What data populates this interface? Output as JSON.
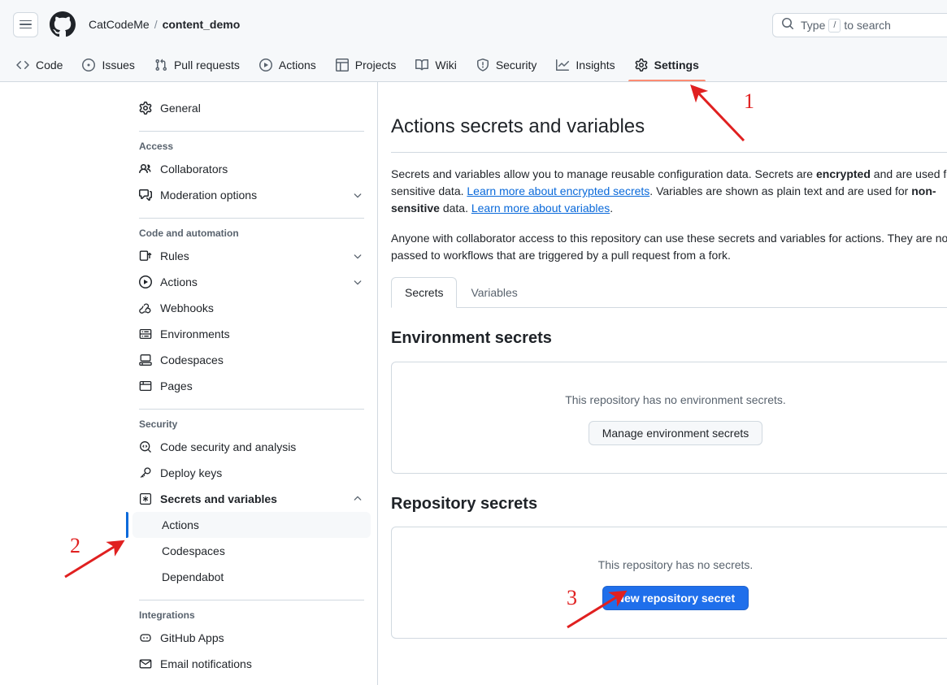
{
  "header": {
    "menu_icon": "hamburger-menu-icon",
    "logo_icon": "github-logo-icon",
    "owner": "CatCodeMe",
    "separator": "/",
    "repo": "content_demo",
    "search": {
      "icon": "search-icon",
      "prefix": "Type",
      "key": "/",
      "suffix": "to search",
      "placeholder": "Type / to search"
    }
  },
  "repo_nav": {
    "items": [
      {
        "label": "Code",
        "icon": "code-icon",
        "active": false
      },
      {
        "label": "Issues",
        "icon": "issue-opened-icon",
        "active": false
      },
      {
        "label": "Pull requests",
        "icon": "git-pull-request-icon",
        "active": false
      },
      {
        "label": "Actions",
        "icon": "play-icon",
        "active": false
      },
      {
        "label": "Projects",
        "icon": "table-icon",
        "active": false
      },
      {
        "label": "Wiki",
        "icon": "book-icon",
        "active": false
      },
      {
        "label": "Security",
        "icon": "shield-icon",
        "active": false
      },
      {
        "label": "Insights",
        "icon": "graph-icon",
        "active": false
      },
      {
        "label": "Settings",
        "icon": "gear-icon",
        "active": true
      }
    ],
    "active_underline_color": "#fd8c73"
  },
  "sidebar": {
    "general": {
      "label": "General",
      "icon": "gear-icon"
    },
    "sections": [
      {
        "title": "Access",
        "items": [
          {
            "label": "Collaborators",
            "icon": "people-icon",
            "chevron": ""
          },
          {
            "label": "Moderation options",
            "icon": "comment-discussion-icon",
            "chevron": "chevron-down-icon"
          }
        ]
      },
      {
        "title": "Code and automation",
        "items": [
          {
            "label": "Rules",
            "icon": "rules-icon",
            "chevron": "chevron-down-icon"
          },
          {
            "label": "Actions",
            "icon": "play-icon",
            "chevron": "chevron-down-icon"
          },
          {
            "label": "Webhooks",
            "icon": "webhook-icon",
            "chevron": ""
          },
          {
            "label": "Environments",
            "icon": "environment-icon",
            "chevron": ""
          },
          {
            "label": "Codespaces",
            "icon": "codespaces-icon",
            "chevron": ""
          },
          {
            "label": "Pages",
            "icon": "browser-icon",
            "chevron": ""
          }
        ]
      },
      {
        "title": "Security",
        "items": [
          {
            "label": "Code security and analysis",
            "icon": "codescan-icon",
            "chevron": ""
          },
          {
            "label": "Deploy keys",
            "icon": "key-icon",
            "chevron": ""
          },
          {
            "label": "Secrets and variables",
            "icon": "asterisk-icon",
            "chevron": "chevron-up-icon",
            "bold": true
          }
        ],
        "subitems": [
          {
            "label": "Actions",
            "selected": true
          },
          {
            "label": "Codespaces",
            "selected": false
          },
          {
            "label": "Dependabot",
            "selected": false
          }
        ]
      },
      {
        "title": "Integrations",
        "items": [
          {
            "label": "GitHub Apps",
            "icon": "apps-icon",
            "chevron": ""
          },
          {
            "label": "Email notifications",
            "icon": "mail-icon",
            "chevron": ""
          }
        ]
      }
    ],
    "selected_indicator_color": "#0969da"
  },
  "main": {
    "title": "Actions secrets and variables",
    "paragraph1": {
      "part1": "Secrets and variables allow you to manage reusable configuration data. Secrets are ",
      "bold1": "encrypted",
      "part2": " and are used for sensitive data. ",
      "link1": "Learn more about encrypted secrets",
      "part3": ". Variables are shown as plain text and are used for ",
      "bold2": "non-sensitive",
      "part4": " data. ",
      "link2": "Learn more about variables",
      "part5": "."
    },
    "paragraph2": "Anyone with collaborator access to this repository can use these secrets and variables for actions. They are not passed to workflows that are triggered by a pull request from a fork.",
    "tabs": [
      {
        "label": "Secrets",
        "active": true
      },
      {
        "label": "Variables",
        "active": false
      }
    ],
    "environment_secrets": {
      "heading": "Environment secrets",
      "empty_text": "This repository has no environment secrets.",
      "button_label": "Manage environment secrets"
    },
    "repository_secrets": {
      "heading": "Repository secrets",
      "empty_text": "This repository has no secrets.",
      "button_label": "New repository secret",
      "button_color": "#1f6feb"
    }
  },
  "annotations": {
    "color": "#e02020",
    "markers": [
      {
        "number": "1",
        "target": "settings-tab"
      },
      {
        "number": "2",
        "target": "sidebar-secrets-actions"
      },
      {
        "number": "3",
        "target": "new-repository-secret-button"
      }
    ]
  }
}
